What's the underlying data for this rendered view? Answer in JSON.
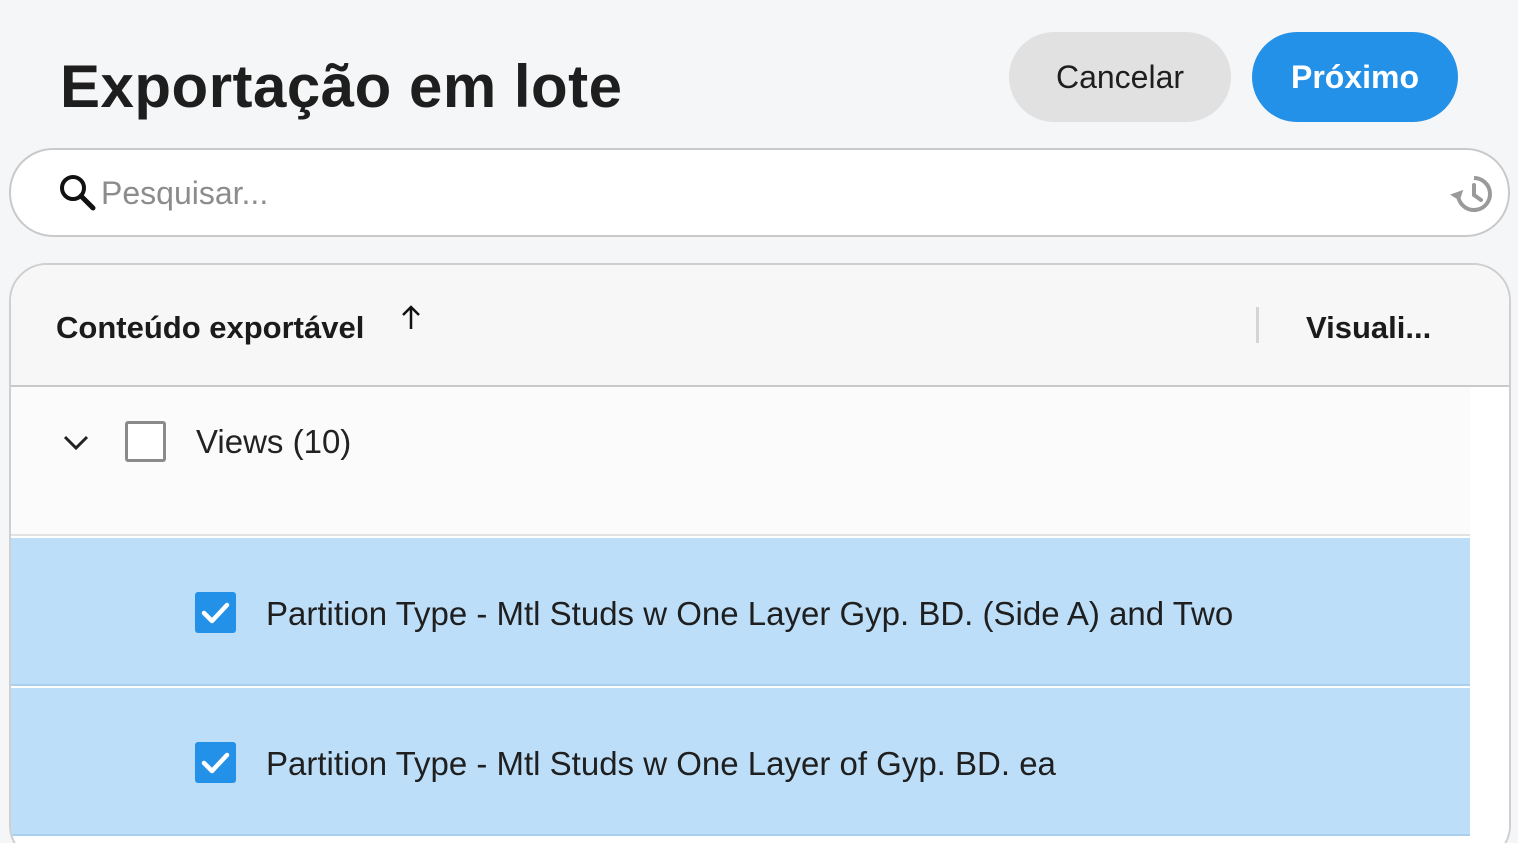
{
  "header": {
    "title": "Exportação em lote",
    "cancel_label": "Cancelar",
    "next_label": "Próximo"
  },
  "search": {
    "placeholder": "Pesquisar...",
    "value": ""
  },
  "table": {
    "columns": {
      "content": "Conteúdo exportável",
      "view": "Visuali..."
    },
    "sort": "ascending",
    "group": {
      "label": "Views (10)",
      "expanded": true,
      "checked": false
    },
    "items": [
      {
        "label": "Partition Type - Mtl Studs w One Layer Gyp. BD. (Side A) and Two",
        "checked": true
      },
      {
        "label": "Partition Type - Mtl Studs w One Layer of Gyp. BD. ea",
        "checked": true
      }
    ]
  },
  "colors": {
    "accent": "#2491e8",
    "selected_row": "#bcdef8",
    "background": "#f5f6f7"
  }
}
